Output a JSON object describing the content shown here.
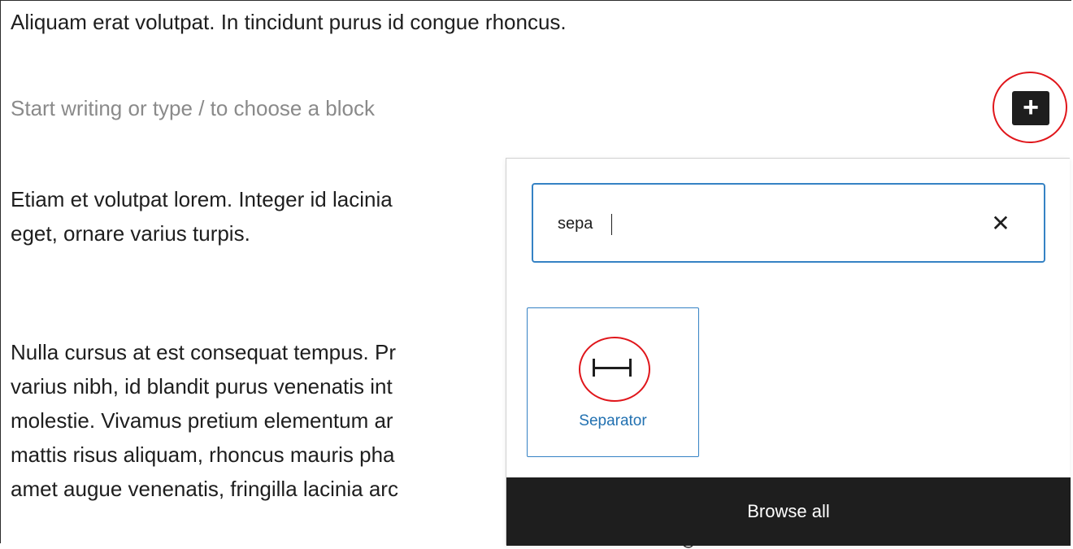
{
  "editor": {
    "paragraph_1": "Aliquam erat volutpat. In tincidunt purus id congue rhoncus.",
    "placeholder": "Start writing or type / to choose a block",
    "paragraph_2": [
      "Etiam et volutpat lorem. Integer id lacinia",
      "eget, ornare varius turpis."
    ],
    "paragraph_3": [
      "Nulla cursus at est consequat tempus. Pr",
      "varius nibh, id blandit purus venenatis int",
      "molestie. Vivamus pretium elementum ar",
      "mattis risus aliquam, rhoncus mauris pha",
      "amet augue venenatis, fringilla lacinia arc"
    ],
    "inserter_icon": "plus-icon",
    "inserter_glyph": "+"
  },
  "inserter": {
    "search_value": "sepa",
    "clear_glyph": "✕",
    "results": [
      {
        "label": "Separator",
        "icon": "separator-icon"
      }
    ],
    "browse_all_label": "Browse all"
  },
  "colors": {
    "highlight_ring": "#e0161b",
    "focus_blue": "#3582c4",
    "link_blue": "#2271b1",
    "dark": "#1e1e1e"
  }
}
